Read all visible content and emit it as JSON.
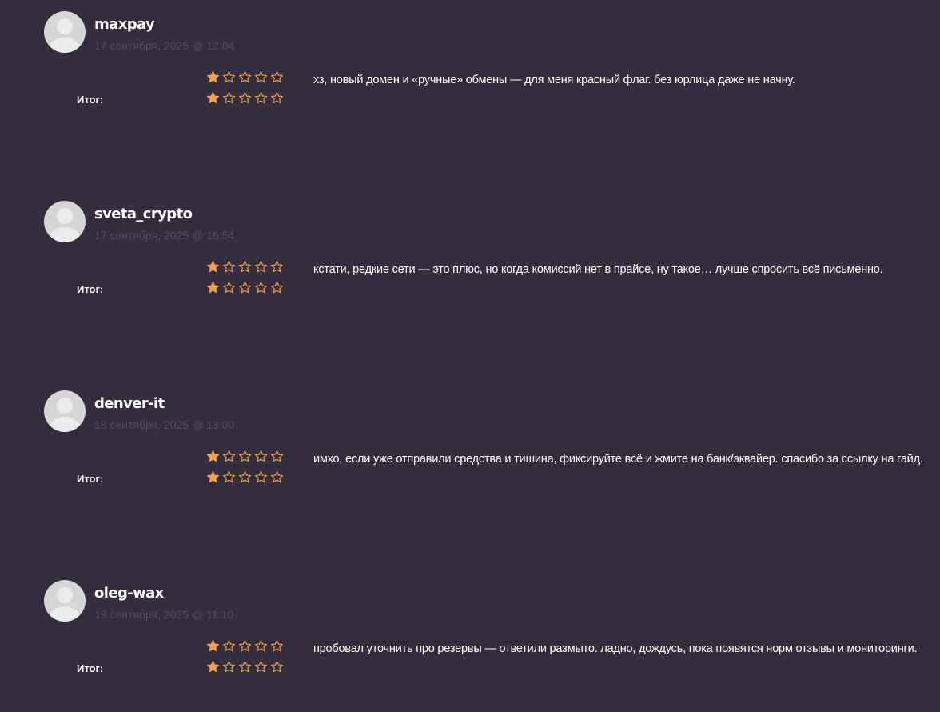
{
  "itog_label": "Итог:",
  "star_color": "#f5a04c",
  "reviews": [
    {
      "username": "maxpay",
      "date": "17 сентября, 2025 @ 12:04",
      "rating": 1,
      "summary_rating": 1,
      "max_rating": 5,
      "comment": "хз, новый домен и «ручные» обмены — для меня красный флаг. без юрлица даже не начну."
    },
    {
      "username": "sveta_crypto",
      "date": "17 сентября, 2025 @ 16:54",
      "rating": 1,
      "summary_rating": 1,
      "max_rating": 5,
      "comment": "кстати, редкие сети — это плюс, но когда комиссий нет в прайсе, ну такое… лучше спросить всё письменно."
    },
    {
      "username": "denver-it",
      "date": "18 сентября, 2025 @ 13:00",
      "rating": 1,
      "summary_rating": 1,
      "max_rating": 5,
      "comment": "имхо, если уже отправили средства и тишина, фиксируйте всё и жмите на банк/эквайер. спасибо за ссылку на гайд."
    },
    {
      "username": "oleg-wax",
      "date": "19 сентября, 2025 @ 11:10",
      "rating": 1,
      "summary_rating": 1,
      "max_rating": 5,
      "comment": "пробовал уточнить про резервы — ответили размыто. ладно, дождусь, пока появятся норм отзывы и мониторинги."
    }
  ]
}
